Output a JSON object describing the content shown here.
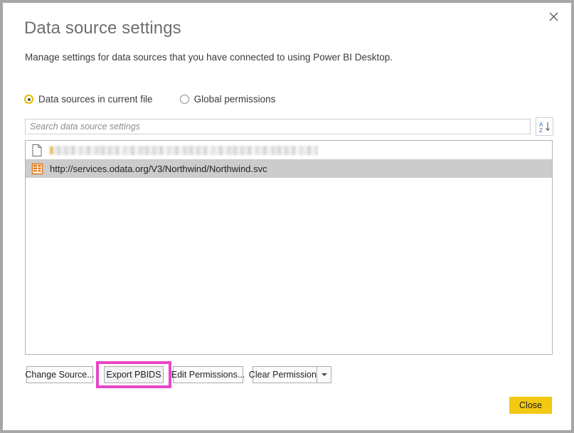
{
  "window": {
    "close_icon": "close-x-icon"
  },
  "header": {
    "title": "Data source settings",
    "description": "Manage settings for data sources that you have connected to using Power BI Desktop."
  },
  "scope_options": [
    {
      "label": "Data sources in current file",
      "selected": true
    },
    {
      "label": "Global permissions",
      "selected": false
    }
  ],
  "search": {
    "placeholder": "Search data source settings",
    "value": "",
    "sort_button": {
      "icon": "sort-az-icon",
      "letters": [
        "A",
        "Z"
      ]
    }
  },
  "source_list": {
    "rows": [
      {
        "icon": "file-document-icon",
        "label": "",
        "redacted": true,
        "selected": false
      },
      {
        "icon": "odata-feed-icon",
        "label": "http://services.odata.org/V3/Northwind/Northwind.svc",
        "redacted": false,
        "selected": true
      }
    ]
  },
  "footer": {
    "buttons": [
      {
        "label": "Change Source...",
        "name": "change-source-button"
      },
      {
        "label": "Export PBIDS",
        "name": "export-pbids-button",
        "highlighted": true
      },
      {
        "label": "Edit Permissions...",
        "name": "edit-permissions-button"
      },
      {
        "label": "Clear Permissions",
        "name": "clear-permissions-button"
      }
    ],
    "clear_permissions_dropdown_icon": "chevron-down-icon",
    "close_label": "Close"
  },
  "colors": {
    "accent_yellow": "#f2c811",
    "radio_selected_ring": "#e8bb00",
    "selection_gray": "#cccccc",
    "annotation_magenta": "#e846c8",
    "odata_orange": "#e07b1e",
    "window_border": "#a6a6a6"
  }
}
